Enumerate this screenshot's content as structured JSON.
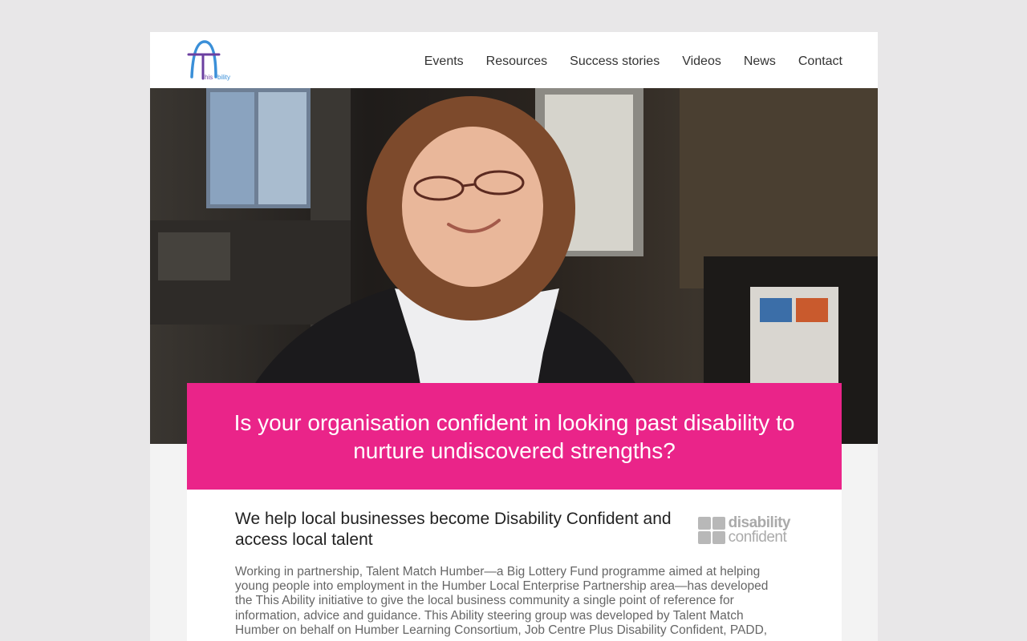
{
  "header": {
    "logo_text": "This Ability",
    "nav": [
      {
        "label": "Events"
      },
      {
        "label": "Resources"
      },
      {
        "label": "Success stories"
      },
      {
        "label": "Videos"
      },
      {
        "label": "News"
      },
      {
        "label": "Contact"
      }
    ]
  },
  "hero": {
    "image_alt": "Smiling young woman with glasses in an office"
  },
  "banner": {
    "headline": "Is your organisation confident in looking past disability to nurture undiscovered strengths?"
  },
  "intro": {
    "heading": "We help local businesses become Disability Confident and access local talent",
    "body": "Working in partnership, Talent Match Humber—a Big Lottery Fund programme aimed at helping young people into employment in the Humber Local Enterprise Partnership area—has developed the This Ability initiative to give the local business community a single point of reference for information, advice and guidance. This Ability steering group was developed by Talent Match Humber on behalf on Humber Learning Consortium, Job Centre Plus Disability Confident, PADD,",
    "badge": {
      "line1": "disability",
      "line2": "confident"
    }
  },
  "colors": {
    "accent": "#ea2489",
    "logo_blue": "#3a8fd8",
    "logo_purple": "#6b3fa0"
  }
}
